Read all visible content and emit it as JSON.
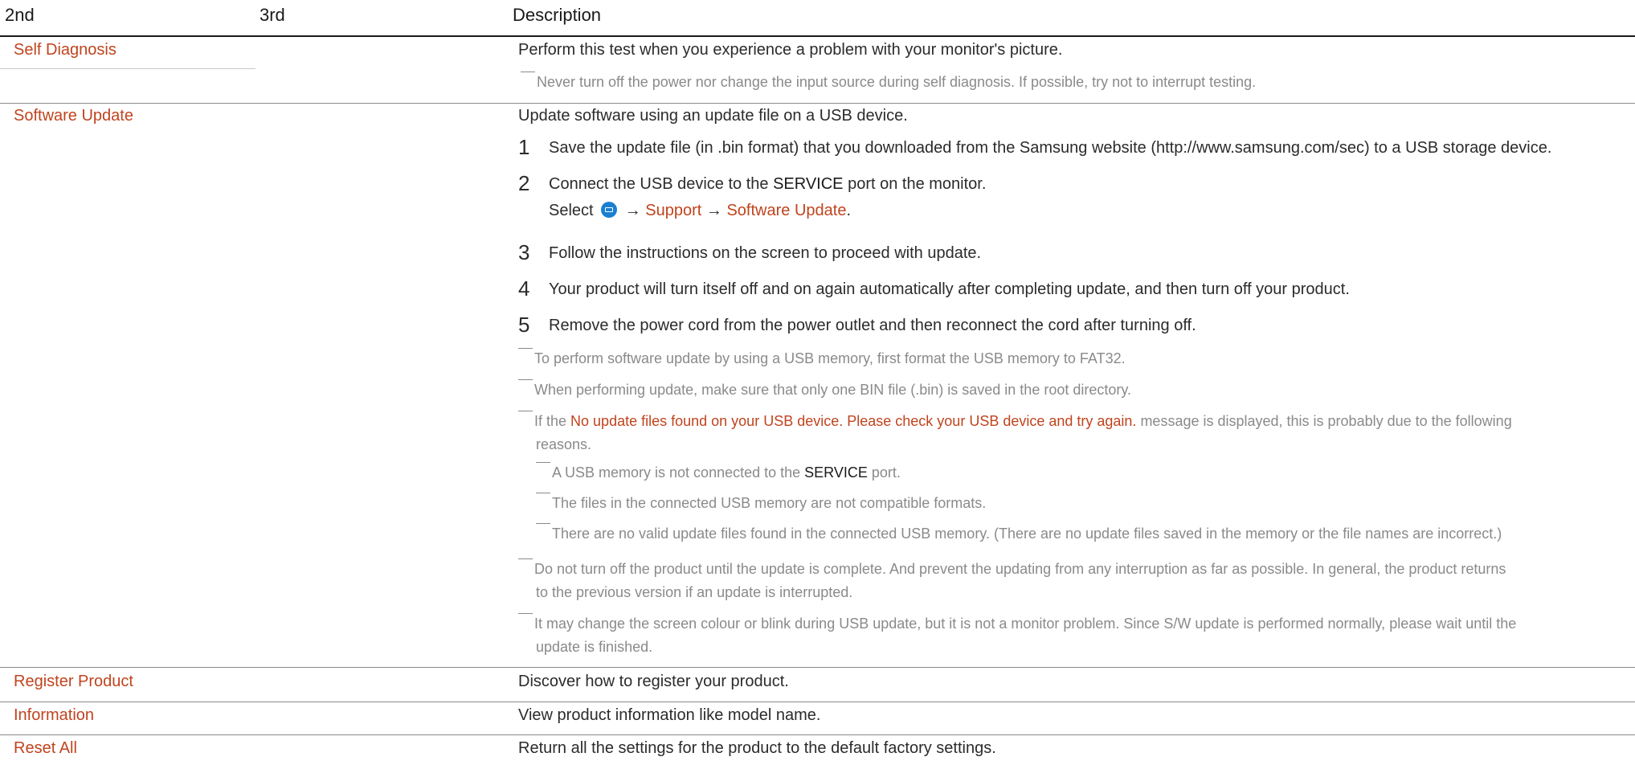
{
  "header": {
    "col_2nd": "2nd",
    "col_3rd": "3rd",
    "col_description": "Description"
  },
  "rows": {
    "self_diagnosis": {
      "label": "Self Diagnosis",
      "description": "Perform this test when you experience a problem with your monitor's picture.",
      "note": "Never turn off the power nor change the input source during self diagnosis. If possible, try not to interrupt testing."
    },
    "software_update": {
      "label": "Software Update",
      "description": "Update software using an update file on a USB device.",
      "steps": [
        {
          "num": "1",
          "text": "Save the update file (in .bin format) that you downloaded from the Samsung website (http://www.samsung.com/sec) to a USB storage device."
        },
        {
          "num": "2",
          "text_before": "Connect the USB device to the ",
          "term": "SERVICE",
          "text_after": " port on the monitor."
        },
        {
          "num": "3",
          "text": "Follow the instructions on the screen to proceed with update."
        },
        {
          "num": "4",
          "text": "Your product will turn itself off and on again automatically after completing update, and then turn off your product."
        },
        {
          "num": "5",
          "text": "Remove the power cord from the power outlet and then reconnect the cord after turning off."
        }
      ],
      "select_line": {
        "select": "Select",
        "arrow1": "→",
        "support": "Support",
        "arrow2": "→",
        "software_update": "Software Update",
        "period": "."
      },
      "notes": {
        "n1": "To perform software update by using a USB memory, first format the USB memory to FAT32.",
        "n2": "When performing update, make sure that only one BIN file (.bin) is saved in the root directory.",
        "n3_before": "If the ",
        "n3_msg": "No update files found on your USB device. Please check your USB device and try again.",
        "n3_after": " message is displayed, this is probably due to the following",
        "n3_cont": "reasons.",
        "sub1_before": "A USB memory is not connected to the ",
        "sub1_term": "SERVICE",
        "sub1_after": " port.",
        "sub2": "The files in the connected USB memory are not compatible formats.",
        "sub3": "There are no valid update files found in the connected USB memory. (There are no update files saved in the memory or the file names are incorrect.)",
        "n4_line1": "Do not turn off the product until the update is complete. And prevent the updating from any interruption as far as possible. In general, the product returns",
        "n4_line2": "to the previous version if an update is interrupted.",
        "n5_line1": "It may change the screen colour or blink during USB update, but it is not a monitor problem. Since S/W update is performed normally, please wait until the",
        "n5_line2": "update is finished."
      }
    },
    "register_product": {
      "label": "Register Product",
      "description": "Discover how to register your product."
    },
    "information": {
      "label": "Information",
      "description": "View product information like model name."
    },
    "reset_all": {
      "label": "Reset All",
      "description": "Return all the settings for the product to the default factory settings."
    }
  }
}
